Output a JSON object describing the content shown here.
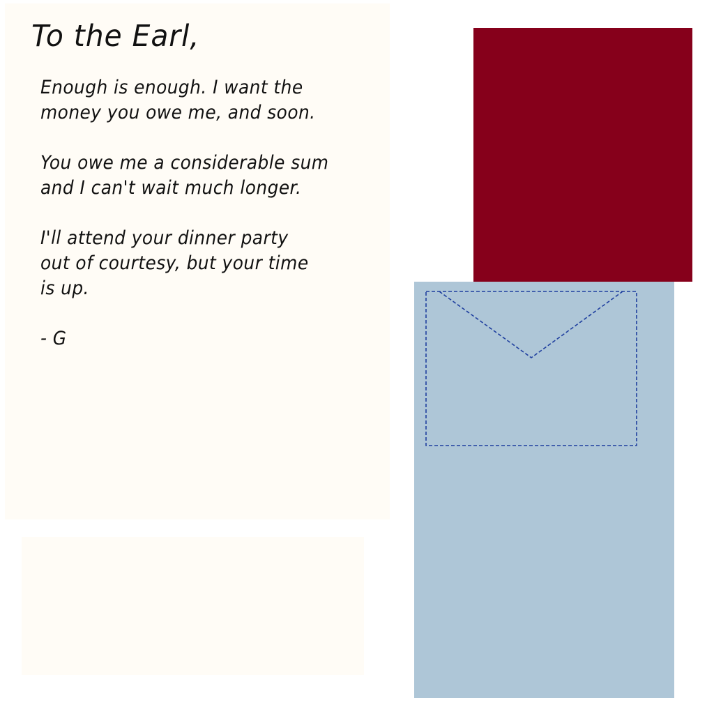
{
  "letter": {
    "greeting": "To the Earl,",
    "lines": [
      "Enough is enough. I want the",
      "money you owe me, and soon.",
      "",
      "You owe me a considerable sum",
      "and I can't wait much longer.",
      "",
      "I'll attend your dinner party",
      "out of courtesy, but your time",
      "is up.",
      "",
      "- G"
    ]
  },
  "colors": {
    "paper": "#fffcf6",
    "wax_card": "#86001b",
    "envelope": "#aec6d7",
    "envelope_stitch": "#1f3f9f",
    "ink": "#111111"
  }
}
